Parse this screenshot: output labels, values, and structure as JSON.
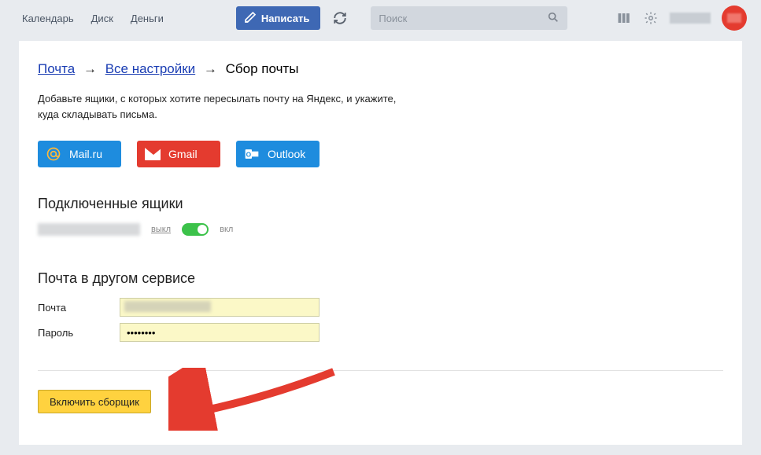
{
  "topbar": {
    "links": [
      "Календарь",
      "Диск",
      "Деньги"
    ],
    "compose": "Написать",
    "search_placeholder": "Поиск"
  },
  "breadcrumb": {
    "mail": "Почта",
    "all_settings": "Все настройки",
    "current": "Сбор почты"
  },
  "intro_text": "Добавьте ящики, с которых хотите пересылать почту на Яндекс, и укажите, куда складывать письма.",
  "providers": {
    "mailru": "Mail.ru",
    "gmail": "Gmail",
    "outlook": "Outlook"
  },
  "connected": {
    "heading": "Подключенные ящики",
    "off_label": "выкл",
    "on_label": "вкл"
  },
  "external": {
    "heading": "Почта в другом сервисе",
    "email_label": "Почта",
    "password_label": "Пароль",
    "password_value": "••••••••"
  },
  "submit_label": "Включить сборщик"
}
